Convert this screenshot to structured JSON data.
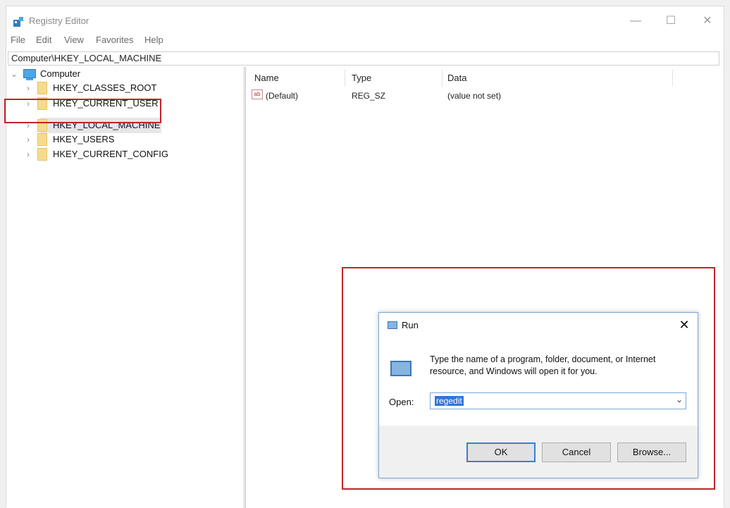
{
  "window": {
    "title": "Registry Editor",
    "controls": {
      "minimize": "—",
      "maximize": "☐",
      "close": "✕"
    }
  },
  "menu": [
    "File",
    "Edit",
    "View",
    "Favorites",
    "Help"
  ],
  "address": "Computer\\HKEY_LOCAL_MACHINE",
  "tree": {
    "root": "Computer",
    "nodes": [
      "HKEY_CLASSES_ROOT",
      "HKEY_CURRENT_USER",
      "HKEY_LOCAL_MACHINE",
      "HKEY_USERS",
      "HKEY_CURRENT_CONFIG"
    ],
    "selected": "HKEY_LOCAL_MACHINE"
  },
  "list": {
    "columns": [
      "Name",
      "Type",
      "Data"
    ],
    "rows": [
      {
        "name": "(Default)",
        "type": "REG_SZ",
        "data": "(value not set)"
      }
    ]
  },
  "run_dialog": {
    "title": "Run",
    "close": "✕",
    "description": "Type the name of a program, folder, document, or Internet resource, and Windows will open it for you.",
    "open_label": "Open:",
    "open_value": "regedit",
    "buttons": {
      "ok": "OK",
      "cancel": "Cancel",
      "browse": "Browse..."
    }
  },
  "icons": {
    "app": "registry-editor-icon",
    "computer": "computer-icon",
    "folder": "folder-icon",
    "string_value": "string-value-icon",
    "run": "run-icon"
  },
  "colors": {
    "highlight": "#c0242b",
    "accent": "#3375d6",
    "folder": "#f5dc8c"
  }
}
